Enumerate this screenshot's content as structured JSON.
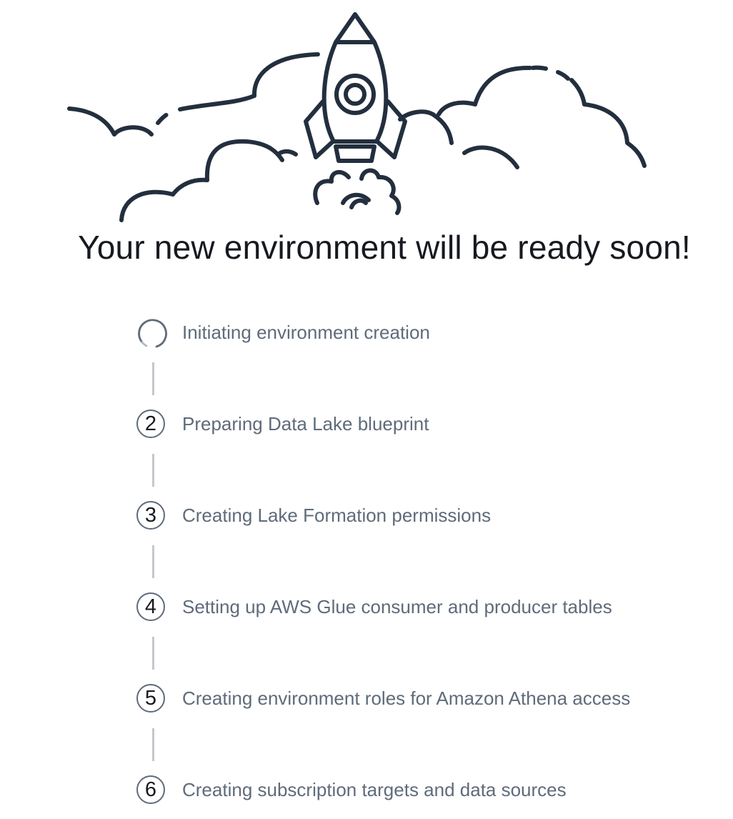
{
  "hero": {
    "illustration_icon": "rocket-launch-with-clouds-icon"
  },
  "page": {
    "title": "Your new environment will be ready soon!"
  },
  "steps": [
    {
      "status": "in-progress",
      "icon": "spinner-icon",
      "label": "Initiating environment creation"
    },
    {
      "status": "pending",
      "number": "2",
      "label": "Preparing Data Lake blueprint"
    },
    {
      "status": "pending",
      "number": "3",
      "label": "Creating Lake Formation permissions"
    },
    {
      "status": "pending",
      "number": "4",
      "label": "Setting up AWS Glue consumer and producer tables"
    },
    {
      "status": "pending",
      "number": "5",
      "label": "Creating environment roles for Amazon Athena access"
    },
    {
      "status": "pending",
      "number": "6",
      "label": "Creating subscription targets and data sources"
    }
  ],
  "colors": {
    "illustration_stroke": "#232f3e",
    "title_text": "#16191f",
    "step_text": "#5f6b7a",
    "connector": "#c6c6cd"
  }
}
